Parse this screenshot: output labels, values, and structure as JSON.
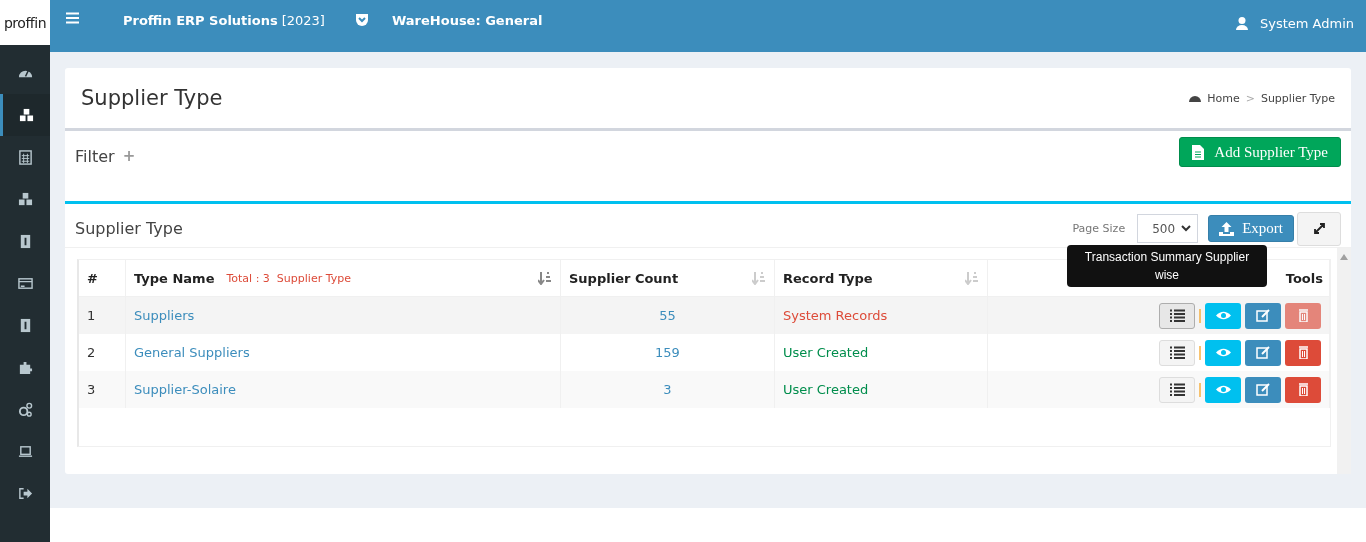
{
  "header": {
    "logo": "proffin",
    "company": "Proffin ERP Solutions",
    "year": "[2023]",
    "warehouse": "WareHouse: General",
    "user": "System Admin"
  },
  "sidebar": {
    "items": [
      {
        "kind": "dashboard",
        "selected": false
      },
      {
        "kind": "cubes",
        "selected": true
      },
      {
        "kind": "calculator",
        "selected": false
      },
      {
        "kind": "cubes",
        "selected": false
      },
      {
        "kind": "badge",
        "selected": false
      },
      {
        "kind": "card",
        "selected": false
      },
      {
        "kind": "badge",
        "selected": false
      },
      {
        "kind": "puzzle",
        "selected": false
      },
      {
        "kind": "gears",
        "selected": false
      },
      {
        "kind": "laptop",
        "selected": false
      },
      {
        "kind": "signout",
        "selected": false
      }
    ]
  },
  "page": {
    "title": "Supplier Type",
    "breadcrumb": [
      "Home",
      "Supplier Type"
    ],
    "breadcrumb_separator": ">"
  },
  "filter": {
    "label": "Filter",
    "toggle": "+",
    "add_button": "Add Supplier Type"
  },
  "list": {
    "title": "Supplier Type",
    "page_size_label": "Page Size",
    "page_size": "500",
    "export_button": "Export",
    "table": {
      "columns": [
        "#",
        "Type Name",
        "Supplier Count",
        "Record Type",
        "Tools"
      ],
      "total": "Total : 3",
      "total_label": "Supplier Type",
      "rows": [
        {
          "no": "1",
          "name": "Suppliers",
          "count": "55",
          "record_type": "System Records",
          "kind": "system",
          "delete_disabled": true,
          "tooltip": "Transaction Summary Supplier wise"
        },
        {
          "no": "2",
          "name": "General Suppliers",
          "count": "159",
          "record_type": "User Created",
          "kind": "user",
          "delete_disabled": false
        },
        {
          "no": "3",
          "name": "Supplier-Solaire",
          "count": "3",
          "record_type": "User Created",
          "kind": "user",
          "delete_disabled": false
        }
      ]
    }
  }
}
